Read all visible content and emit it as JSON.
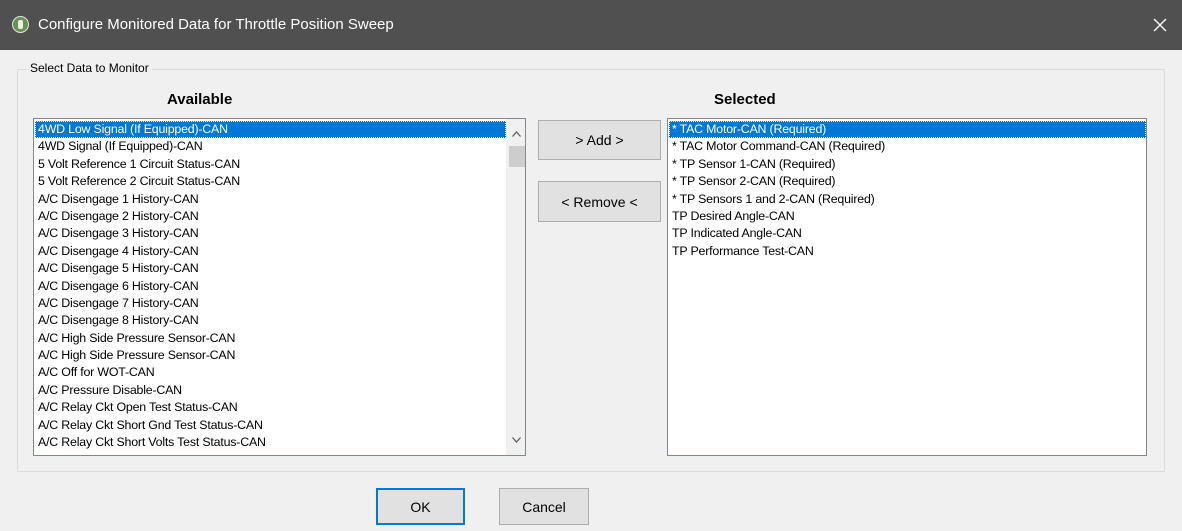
{
  "window": {
    "title": "Configure Monitored Data for Throttle Position Sweep",
    "title_bar_color": "#505050",
    "app_icon": "app-icon",
    "close_icon": "close-icon",
    "close_glyph": "✕"
  },
  "group": {
    "label": "Select Data to Monitor"
  },
  "available": {
    "heading": "Available",
    "items": [
      "4WD Low Signal (If Equipped)-CAN",
      "4WD Signal (If Equipped)-CAN",
      "5 Volt Reference 1 Circuit Status-CAN",
      "5 Volt Reference 2 Circuit Status-CAN",
      "A/C Disengage 1 History-CAN",
      "A/C Disengage 2 History-CAN",
      "A/C Disengage 3 History-CAN",
      "A/C Disengage 4 History-CAN",
      "A/C Disengage 5 History-CAN",
      "A/C Disengage 6 History-CAN",
      "A/C Disengage 7 History-CAN",
      "A/C Disengage 8 History-CAN",
      "A/C High Side Pressure Sensor-CAN",
      "A/C High Side Pressure Sensor-CAN",
      "A/C Off for WOT-CAN",
      "A/C Pressure Disable-CAN",
      "A/C Relay Ckt Open Test Status-CAN",
      "A/C Relay Ckt Short Gnd Test Status-CAN",
      "A/C Relay Ckt Short Volts Test Status-CAN"
    ],
    "selected_index": 0
  },
  "selected": {
    "heading": "Selected",
    "items": [
      "* TAC Motor-CAN (Required)",
      "* TAC Motor Command-CAN (Required)",
      "* TP Sensor 1-CAN (Required)",
      "* TP Sensor 2-CAN (Required)",
      "* TP Sensors 1 and 2-CAN (Required)",
      "TP Desired Angle-CAN",
      "TP Indicated Angle-CAN",
      "TP Performance Test-CAN"
    ],
    "selected_index": 0
  },
  "buttons": {
    "add": "> Add >",
    "remove": "< Remove <",
    "ok": "OK",
    "cancel": "Cancel"
  },
  "colors": {
    "selection": "#0078d7",
    "dialog_background": "#f0f0f0"
  }
}
